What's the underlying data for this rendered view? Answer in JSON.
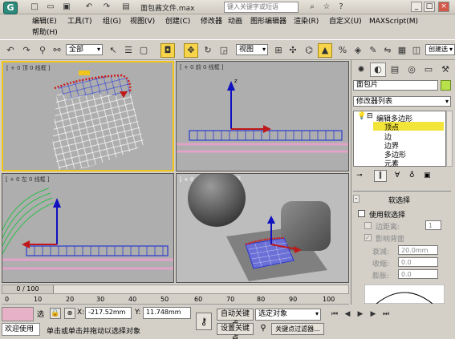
{
  "title": {
    "file_name": "面包酱文件.max",
    "search_placeholder": "键入关键字或短语"
  },
  "menu": {
    "row1": [
      "编辑(E)",
      "工具(T)",
      "组(G)",
      "视图(V)",
      "创建(C)",
      "修改器",
      "动画",
      "图形编辑器",
      "渲染(R)",
      "自定义(U)",
      "MAXScript(M)"
    ],
    "row2": [
      "帮助(H)"
    ]
  },
  "toolbar": {
    "selection_filter": "全部",
    "ref_coord": "视图",
    "create_sel_label": "创建选"
  },
  "viewports": {
    "top": "[ + 0 顶 0 线框 ]",
    "front": "[ + 0 前 0 线框 ]",
    "left": "[ + 0 左 0 线框 ]",
    "persp": "[ + 0 Camera001 0 平"
  },
  "panel": {
    "object_name": "面包片",
    "modifier_list": "修改器列表",
    "stack": [
      "编辑多边形",
      "顶点",
      "边",
      "边界",
      "多边形",
      "元素"
    ],
    "soft_rollout": "软选择",
    "use_soft": "使用软选择",
    "edge_dist": "边距离:",
    "edge_dist_val": "1",
    "affect_back": "影响背面",
    "falloff_label": "衰减:",
    "falloff_val": "20.0mm",
    "pinch_label": "收缩:",
    "pinch_val": "0.0",
    "bubble_label": "膨胀:",
    "bubble_val": "0.0"
  },
  "timeline": {
    "frame": "0 / 100",
    "ticks": [
      "0",
      "10",
      "20",
      "30",
      "40",
      "50",
      "60",
      "70",
      "80",
      "90",
      "100"
    ]
  },
  "status": {
    "selected": "选",
    "x_label": "X:",
    "x_val": "-217.52mm",
    "y_label": "Y:",
    "y_val": "11.748mm",
    "welcome": "欢迎使用",
    "prompt": "单击或单击并拖动以选择对象",
    "auto_key": "自动关键点",
    "set_key": "设置关键点",
    "key_target": "选定对象",
    "key_filters": "关键点过滤器..."
  },
  "colors": {
    "active_border": "#f0c419",
    "viewport_bg": "#aeaeae",
    "mesh": "#2a3acc",
    "mesh_sel": "#d11a1a",
    "grid_line": "#e2a3c8"
  }
}
